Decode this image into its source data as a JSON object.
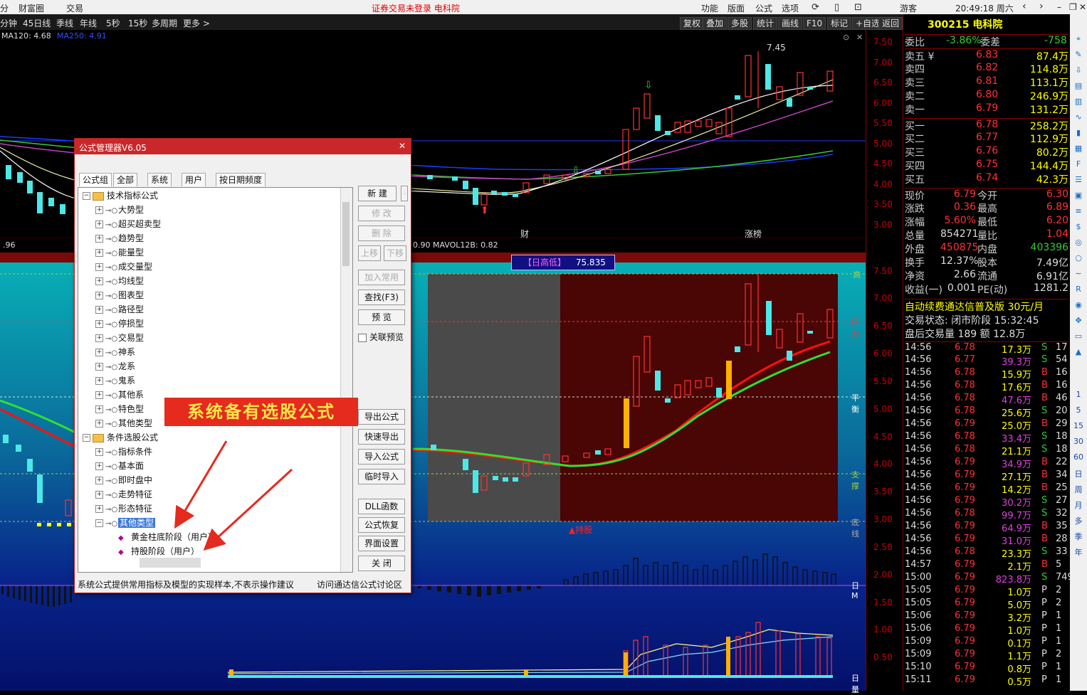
{
  "menubar": {
    "items": [
      "分",
      "财富圈",
      "交易"
    ],
    "status": "证券交易未登录  电科院",
    "right_items": [
      "功能",
      "版面",
      "公式",
      "选项"
    ],
    "user": "游客",
    "time": "20:49:18 周六"
  },
  "period_bar": {
    "items": [
      "分钟",
      "45日线",
      "季线",
      "年线",
      "5秒",
      "15秒",
      "多周期",
      "更多 >"
    ],
    "tools": [
      "复权",
      "叠加",
      "多股",
      "统计",
      "画线",
      "F10",
      "标记",
      "+自选",
      "返回"
    ]
  },
  "ma_legend": {
    "ma120": "MA120: 4.68",
    "ma250": "MA250: 4.91"
  },
  "k_chart": {
    "peak_label": "7.45",
    "markers": [
      "财",
      "涨榜"
    ],
    "vol_label": "0.90  MAVOL12B: 0.82",
    "left_value": ".96",
    "axis": [
      "7.50",
      "7.00",
      "6.50",
      "6.00",
      "5.50",
      "5.00",
      "4.50",
      "4.00",
      "3.50",
      "3.00"
    ]
  },
  "indicator": {
    "badge_label": "【日高低】",
    "badge_value": "75.835",
    "hold_label": "▲持股",
    "axis": [
      "7.50",
      "7.00",
      "6.50",
      "6.00",
      "5.50",
      "5.00",
      "4.50",
      "4.00",
      "3.50",
      "3.00",
      "2.50",
      "2.00",
      "1.50",
      "1.00",
      "0.50"
    ],
    "side_labels": [
      "高",
      "压力",
      "平衡",
      "支撑",
      "底线",
      "日M",
      "日量"
    ]
  },
  "colors": {
    "up": "#ff3333",
    "down": "#33cc33",
    "cyan_candle": "#4ce8e8",
    "accent_red": "#c8282a"
  },
  "dialog": {
    "title": "公式管理器V6.05",
    "tabs": [
      "公式组",
      "全部",
      "系统",
      "用户",
      "按日期频度"
    ],
    "tree": [
      {
        "label": "技术指标公式",
        "level": 0,
        "type": "folder",
        "expanded": true
      },
      {
        "label": "大势型",
        "level": 1
      },
      {
        "label": "超买超卖型",
        "level": 1
      },
      {
        "label": "趋势型",
        "level": 1
      },
      {
        "label": "能量型",
        "level": 1
      },
      {
        "label": "成交量型",
        "level": 1
      },
      {
        "label": "均线型",
        "level": 1
      },
      {
        "label": "图表型",
        "level": 1
      },
      {
        "label": "路径型",
        "level": 1
      },
      {
        "label": "停损型",
        "level": 1
      },
      {
        "label": "交易型",
        "level": 1
      },
      {
        "label": "神系",
        "level": 1
      },
      {
        "label": "龙系",
        "level": 1
      },
      {
        "label": "鬼系",
        "level": 1
      },
      {
        "label": "其他系",
        "level": 1
      },
      {
        "label": "特色型",
        "level": 1
      },
      {
        "label": "其他类型",
        "level": 1
      },
      {
        "label": "条件选股公式",
        "level": 0,
        "type": "folder",
        "expanded": true
      },
      {
        "label": "指标条件",
        "level": 1
      },
      {
        "label": "基本面",
        "level": 1
      },
      {
        "label": "即时盘中",
        "level": 1
      },
      {
        "label": "走势特征",
        "level": 1
      },
      {
        "label": "形态特征",
        "level": 1
      },
      {
        "label": "其他类型",
        "level": 1,
        "selected": true
      },
      {
        "label": "黄金柱底阶段（用户）",
        "level": 2
      },
      {
        "label": "持股阶段（用户）",
        "level": 2
      }
    ],
    "buttons": [
      "新 建",
      "修 改",
      "删 除",
      "上移",
      "下移",
      "加入常用",
      "查找(F3)",
      "预 览",
      "导出公式",
      "快速导出",
      "导入公式",
      "临时导入",
      "DLL函数",
      "公式恢复",
      "界面设置",
      "关 闭"
    ],
    "checkbox_label": "关联预览",
    "footer_left": "系统公式提供常用指标及模型的实现样本,不表示操作建议",
    "footer_right": "访问通达信公式讨论区"
  },
  "annotation": "系统备有选股公式",
  "quote": {
    "code_name": "300215 电科院",
    "weibi_label": "委比",
    "weibi": "-3.86%",
    "weicha_label": "委差",
    "weicha": "-758",
    "sells": [
      {
        "label": "卖五 ¥",
        "price": "6.83",
        "vol": "87.4万"
      },
      {
        "label": "卖四",
        "price": "6.82",
        "vol": "114.8万"
      },
      {
        "label": "卖三",
        "price": "6.81",
        "vol": "113.1万"
      },
      {
        "label": "卖二",
        "price": "6.80",
        "vol": "246.9万"
      },
      {
        "label": "卖一",
        "price": "6.79",
        "vol": "131.2万"
      }
    ],
    "buys": [
      {
        "label": "买一",
        "price": "6.78",
        "vol": "258.2万"
      },
      {
        "label": "买二",
        "price": "6.77",
        "vol": "112.9万"
      },
      {
        "label": "买三",
        "price": "6.76",
        "vol": "80.2万"
      },
      {
        "label": "买四",
        "price": "6.75",
        "vol": "144.4万"
      },
      {
        "label": "买五",
        "price": "6.74",
        "vol": "42.3万"
      }
    ],
    "stats": [
      {
        "l1": "现价",
        "v1": "6.79",
        "l2": "今开",
        "v2": "6.30"
      },
      {
        "l1": "涨跌",
        "v1": "0.36",
        "l2": "最高",
        "v2": "6.89"
      },
      {
        "l1": "涨幅",
        "v1": "5.60%",
        "l2": "最低",
        "v2": "6.20"
      },
      {
        "l1": "总量",
        "v1": "854271",
        "l2": "量比",
        "v2": "1.04"
      },
      {
        "l1": "外盘",
        "v1": "450875",
        "l2": "内盘",
        "v2": "403396"
      },
      {
        "l1": "换手",
        "v1": "12.37%",
        "l2": "股本",
        "v2": "7.49亿"
      },
      {
        "l1": "净资",
        "v1": "2.66",
        "l2": "流通",
        "v2": "6.91亿"
      },
      {
        "l1": "收益(一)",
        "v1": "0.001",
        "l2": "PE(动)",
        "v2": "1281.2"
      }
    ],
    "ad": "自动续费通达信普及版  30元/月",
    "trade_status": "交易状态: 闭市阶段 15:32:45",
    "after_hours": "盘后交易量 189 额 12.8万",
    "ticks": [
      [
        "14:56",
        "6.78",
        "17.3万",
        "S",
        "17"
      ],
      [
        "14:56",
        "6.77",
        "39.3万",
        "S",
        "54"
      ],
      [
        "14:56",
        "6.78",
        "15.9万",
        "B",
        "16"
      ],
      [
        "14:56",
        "6.78",
        "17.6万",
        "B",
        "16"
      ],
      [
        "14:56",
        "6.78",
        "47.6万",
        "B",
        "46"
      ],
      [
        "14:56",
        "6.78",
        "25.6万",
        "S",
        "20"
      ],
      [
        "14:56",
        "6.79",
        "25.0万",
        "B",
        "29"
      ],
      [
        "14:56",
        "6.78",
        "33.4万",
        "S",
        "18"
      ],
      [
        "14:56",
        "6.78",
        "21.1万",
        "S",
        "18"
      ],
      [
        "14:56",
        "6.79",
        "34.9万",
        "B",
        "22"
      ],
      [
        "14:56",
        "6.79",
        "27.1万",
        "B",
        "34"
      ],
      [
        "14:56",
        "6.79",
        "14.2万",
        "B",
        "25"
      ],
      [
        "14:56",
        "6.79",
        "30.2万",
        "S",
        "27"
      ],
      [
        "14:56",
        "6.78",
        "99.7万",
        "S",
        "32"
      ],
      [
        "14:56",
        "6.79",
        "64.9万",
        "B",
        "35"
      ],
      [
        "14:56",
        "6.79",
        "31.0万",
        "B",
        "28"
      ],
      [
        "14:56",
        "6.78",
        "23.3万",
        "S",
        "33"
      ],
      [
        "14:57",
        "6.79",
        "2.1万",
        "B",
        "5"
      ],
      [
        "15:00",
        "6.79",
        "823.8万",
        "S",
        "749"
      ],
      [
        "15:05",
        "6.79",
        "1.0万",
        "P",
        "2"
      ],
      [
        "15:05",
        "6.79",
        "5.0万",
        "P",
        "2"
      ],
      [
        "15:06",
        "6.79",
        "3.2万",
        "P",
        "1"
      ],
      [
        "15:06",
        "6.79",
        "1.0万",
        "P",
        "1"
      ],
      [
        "15:09",
        "6.79",
        "0.1万",
        "P",
        "1"
      ],
      [
        "15:09",
        "6.79",
        "1.1万",
        "P",
        "2"
      ],
      [
        "15:10",
        "6.79",
        "0.8万",
        "P",
        "1"
      ],
      [
        "15:11",
        "6.79",
        "0.5万",
        "P",
        "1"
      ]
    ]
  },
  "side_toolbar": [
    "1",
    "5",
    "15",
    "30",
    "60",
    "日",
    "周",
    "月",
    "多",
    "季",
    "年"
  ]
}
